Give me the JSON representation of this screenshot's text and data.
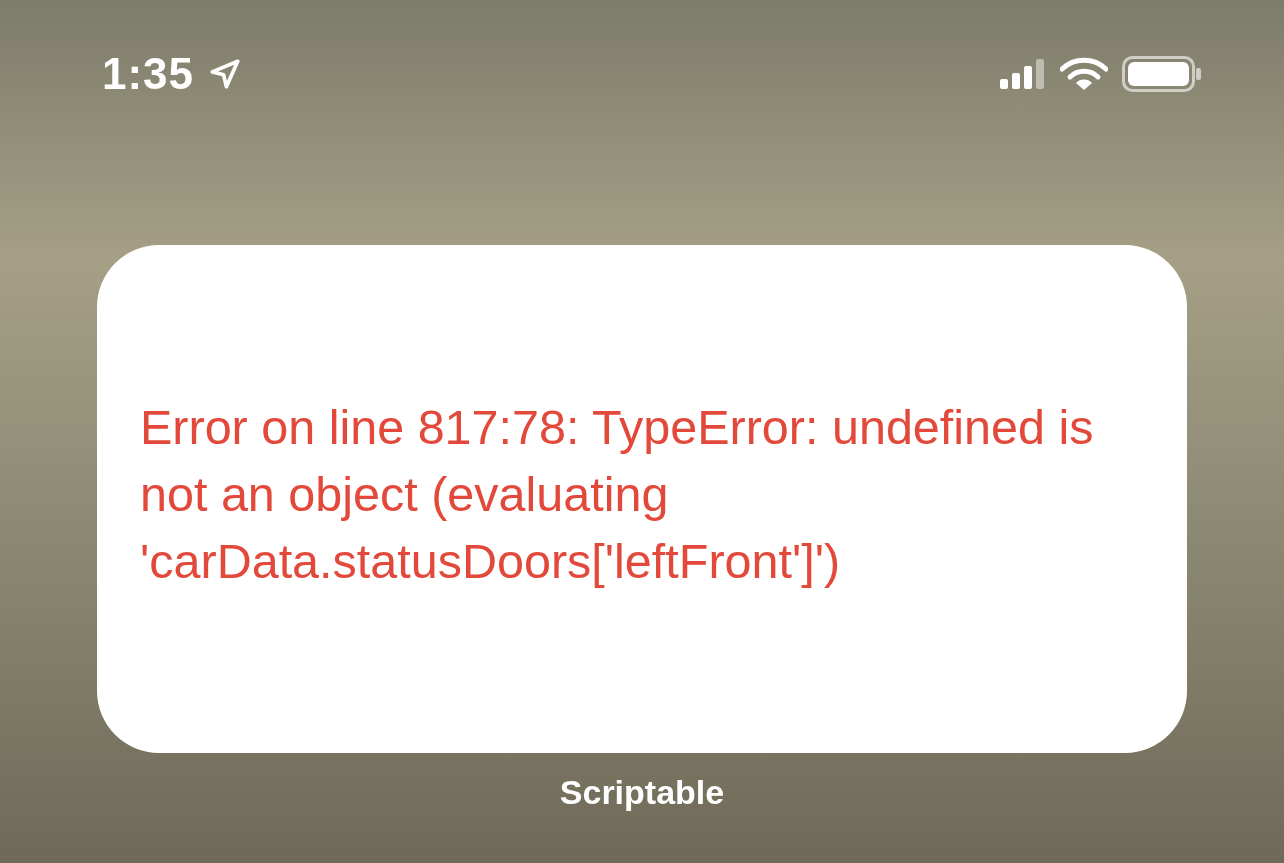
{
  "status_bar": {
    "time": "1:35"
  },
  "widget": {
    "message": "Error on line 817:78: TypeError: undefined is not an object (evaluating 'carData.statusDoors['leftFront']')",
    "app_name": "Scriptable"
  }
}
